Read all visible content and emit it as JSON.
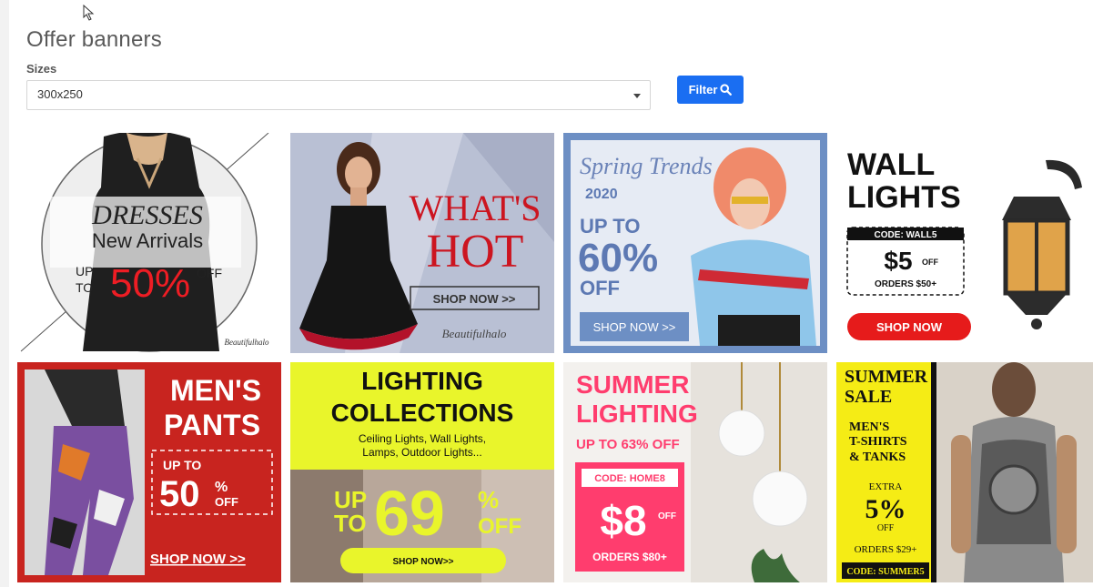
{
  "page": {
    "title": "Offer banners"
  },
  "filter": {
    "sizes_label": "Sizes",
    "selected_size": "300x250",
    "filter_button": "Filter"
  },
  "banners": [
    {
      "headline": "DRESSES",
      "subhead": "New Arrivals",
      "up": "UP",
      "to": "TO",
      "discount": "50%",
      "off": "OFF",
      "brand": "Beautifulhalo"
    },
    {
      "headline_1": "WHAT'S",
      "headline_2": "HOT",
      "cta": "SHOP NOW >>",
      "brand": "Beautifulhalo"
    },
    {
      "script": "Spring Trends",
      "year": "2020",
      "up_to": "UP TO",
      "discount": "60%",
      "off": "OFF",
      "cta": "SHOP NOW >>"
    },
    {
      "headline_1": "WALL",
      "headline_2": "LIGHTS",
      "code": "CODE: WALL5",
      "amount": "$5",
      "off": "OFF",
      "orders": "ORDERS $50+",
      "cta": "SHOP NOW"
    },
    {
      "headline_1": "MEN'S",
      "headline_2": "PANTS",
      "up_to": "UP TO",
      "discount": "50",
      "percent": "%",
      "off": "OFF",
      "cta": "SHOP NOW >>"
    },
    {
      "headline_1": "LIGHTING",
      "headline_2": "COLLECTIONS",
      "sub_1": "Ceiling Lights, Wall Lights,",
      "sub_2": "Lamps, Outdoor Lights...",
      "up": "UP",
      "to": "TO",
      "discount": "69",
      "percent": "%",
      "off": "OFF",
      "cta": "SHOP NOW>>"
    },
    {
      "headline_1": "SUMMER",
      "headline_2": "LIGHTING",
      "up_to": "UP TO 63% OFF",
      "code": "CODE: HOME8",
      "amount": "$8",
      "off": "OFF",
      "orders": "ORDERS $80+"
    },
    {
      "headline_1": "SUMMER",
      "headline_2": "SALE",
      "sub_1": "MEN'S",
      "sub_2": "T-SHIRTS",
      "sub_3": "& TANKS",
      "extra": "EXTRA",
      "discount": "5%",
      "off": "OFF",
      "orders": "ORDERS $29+",
      "code": "CODE: SUMMER5"
    }
  ],
  "colors": {
    "accent": "#1a6ef2",
    "red": "#e61b1b",
    "pink": "#ff3d6e",
    "yellow": "#e9f52b"
  }
}
